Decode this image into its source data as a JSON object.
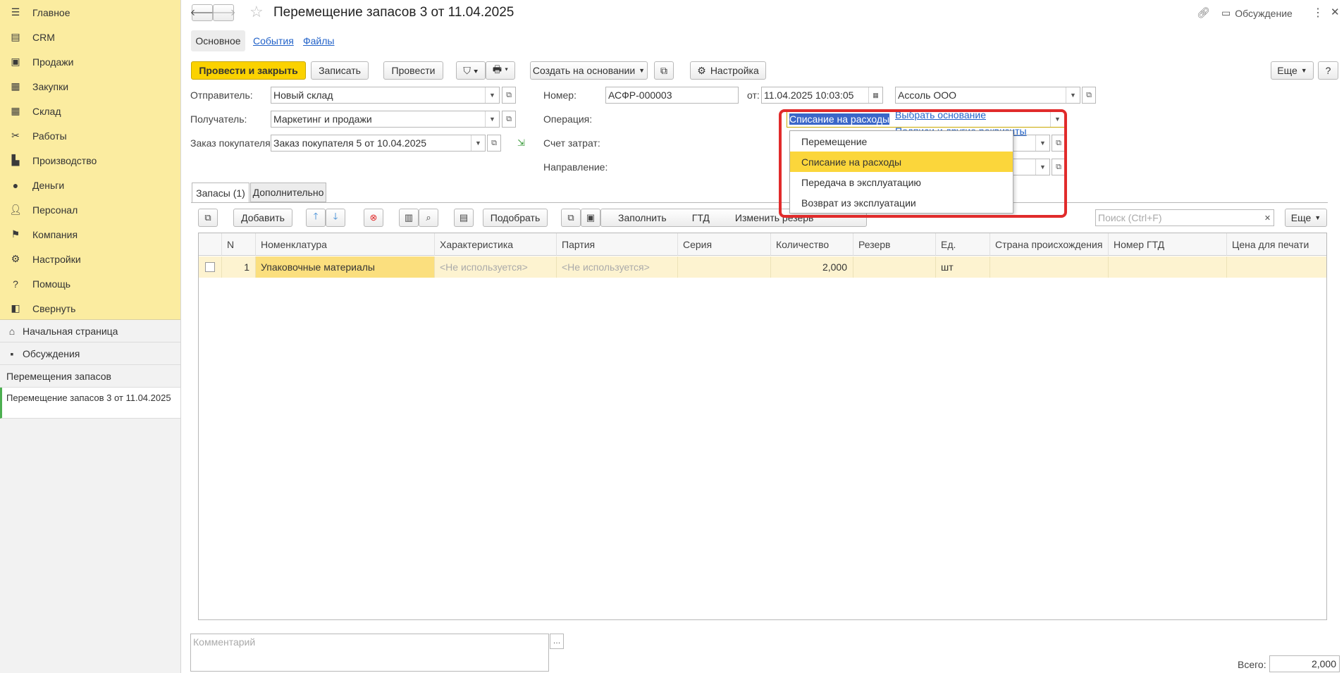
{
  "sidebar": {
    "sections": [
      {
        "label": "Главное",
        "icon": "menu-icon"
      },
      {
        "label": "CRM",
        "icon": "crm-icon"
      },
      {
        "label": "Продажи",
        "icon": "basket-icon"
      },
      {
        "label": "Закупки",
        "icon": "purchases-icon"
      },
      {
        "label": "Склад",
        "icon": "warehouse-icon"
      },
      {
        "label": "Работы",
        "icon": "tools-icon"
      },
      {
        "label": "Производство",
        "icon": "factory-icon"
      },
      {
        "label": "Деньги",
        "icon": "money-icon"
      },
      {
        "label": "Персонал",
        "icon": "person-icon"
      },
      {
        "label": "Компания",
        "icon": "flag-icon"
      },
      {
        "label": "Настройки",
        "icon": "gear-icon"
      },
      {
        "label": "Помощь",
        "icon": "help-icon"
      },
      {
        "label": "Свернуть",
        "icon": "collapse-icon"
      }
    ],
    "home": "Начальная страница",
    "discussions": "Обсуждения",
    "open_header": "Перемещения запасов",
    "open_doc": "Перемещение запасов 3 от 11.04.2025"
  },
  "header": {
    "title": "Перемещение запасов 3 от 11.04.2025",
    "discussion": "Обсуждение",
    "tabs": [
      "Основное",
      "События",
      "Файлы"
    ]
  },
  "toolbar": {
    "post_close": "Провести и закрыть",
    "save": "Записать",
    "post": "Провести",
    "create_based": "Создать на основании",
    "settings": "Настройка",
    "more": "Еще",
    "help": "?"
  },
  "form": {
    "sender_label": "Отправитель:",
    "sender_value": "Новый склад",
    "recipient_label": "Получатель:",
    "recipient_value": "Маркетинг и продажи",
    "order_label": "Заказ покупателя:",
    "order_value": "Заказ покупателя 5 от 10.04.2025",
    "number_label": "Номер:",
    "number_value": "АСФР-000003",
    "date_label": "от:",
    "date_value": "11.04.2025 10:03:05",
    "org_value": "Ассоль ООО",
    "operation_label": "Операция:",
    "operation_value": "Списание на расходы",
    "cost_label": "Счет затрат:",
    "direction_label": "Направление:",
    "choose_basis": "Выбрать основание",
    "signatures": "Подписи и другие реквизиты"
  },
  "operation_dropdown": {
    "options": [
      "Перемещение",
      "Списание на расходы",
      "Передача в эксплуатацию",
      "Возврат из эксплуатации"
    ],
    "selected": "Списание на расходы"
  },
  "tabs": {
    "items": [
      "Запасы (1)",
      "Дополнительно"
    ]
  },
  "table_toolbar": {
    "add": "Добавить",
    "pick": "Подобрать",
    "search_placeholder": "Поиск (Ctrl+F)",
    "more": "Еще",
    "hidden_fill": "Заполнить",
    "hidden_gtd": "ГТД",
    "hidden_reserve": "Изменить резерв"
  },
  "table": {
    "columns": [
      "N",
      "Номенклатура",
      "Характеристика",
      "Партия",
      "Серия",
      "Количество",
      "Резерв",
      "Ед.",
      "Страна происхождения",
      "Номер ГТД",
      "Цена для печати"
    ],
    "rows": [
      {
        "n": "1",
        "item": "Упаковочные материалы",
        "characteristic": "<Не используется>",
        "batch": "<Не используется>",
        "series": "",
        "quantity": "2,000",
        "reserve": "",
        "unit": "шт",
        "country": "",
        "gtd": "",
        "price": ""
      }
    ]
  },
  "footer": {
    "comment_placeholder": "Комментарий",
    "total_label": "Всего:",
    "total_value": "2,000"
  },
  "colors": {
    "accent": "#fbd200",
    "sidebar": "#fbeca0",
    "highlight": "#e12b2b",
    "link": "#2363c9"
  }
}
